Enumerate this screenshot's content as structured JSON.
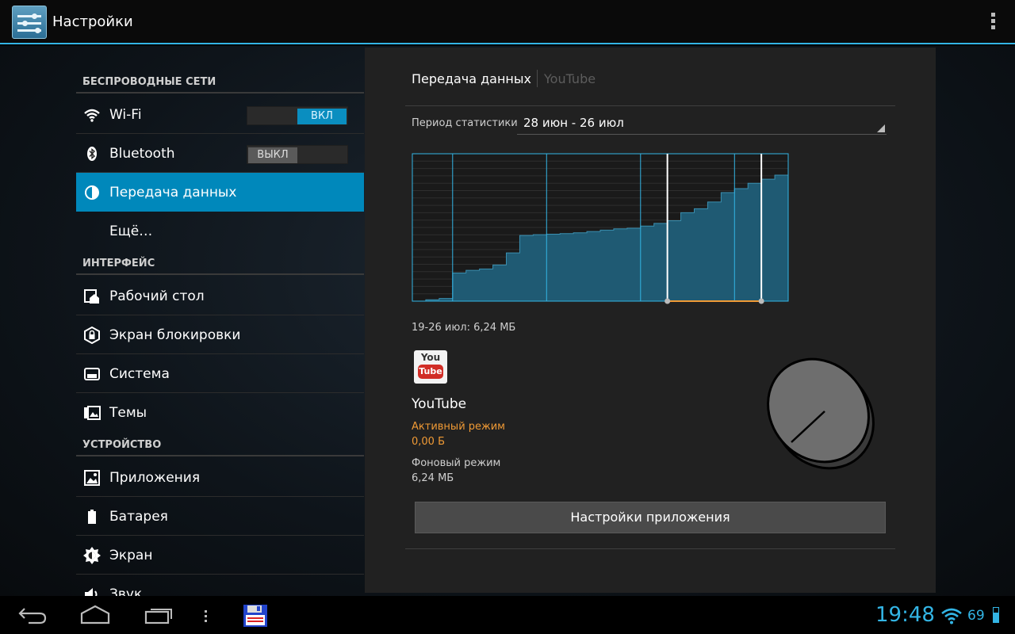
{
  "actionbar": {
    "title": "Настройки"
  },
  "sidebar": {
    "wireless_header": "БЕСПРОВОДНЫЕ СЕТИ",
    "wifi": {
      "label": "Wi-Fi",
      "toggle": "ВКЛ"
    },
    "bluetooth": {
      "label": "Bluetooth",
      "toggle": "ВЫКЛ"
    },
    "data_usage": {
      "label": "Передача данных"
    },
    "more": {
      "label": "Ещё…"
    },
    "interface_header": "ИНТЕРФЕЙС",
    "home": {
      "label": "Рабочий стол"
    },
    "lockscreen": {
      "label": "Экран блокировки"
    },
    "system": {
      "label": "Система"
    },
    "themes": {
      "label": "Темы"
    },
    "device_header": "УСТРОЙСТВО",
    "apps": {
      "label": "Приложения"
    },
    "battery": {
      "label": "Батарея"
    },
    "display": {
      "label": "Экран"
    },
    "sound": {
      "label": "Звук"
    }
  },
  "panel": {
    "title": "Передача данных",
    "subtitle": "YouTube",
    "period_label": "Период статистики",
    "period_value": "28 июн - 26 июл",
    "range_label": "19-26 июл: 6,24 МБ",
    "app": {
      "icon_top": "You",
      "icon_bottom": "Tube",
      "name": "YouTube",
      "foreground_label": "Активный режим",
      "foreground_value": "0,00 Б",
      "background_label": "Фоновый режим",
      "background_value": "6,24 МБ"
    },
    "settings_button": "Настройки приложения"
  },
  "statusbar": {
    "time": "19:48",
    "battery": "69"
  },
  "colors": {
    "accent": "#33b5e5",
    "selected": "#0088bb",
    "foreground_usage": "#f09a35",
    "chart_fill": "#1f5a73"
  },
  "chart_data": {
    "type": "area",
    "x": [
      0,
      1,
      2,
      3,
      4,
      5,
      6,
      7,
      8,
      9,
      10,
      11,
      12,
      13,
      14,
      15,
      16,
      17,
      18,
      19,
      20,
      21,
      22,
      23,
      24,
      25,
      26,
      27,
      28
    ],
    "values": [
      0.0,
      0.05,
      0.1,
      1.05,
      1.15,
      1.2,
      1.35,
      1.8,
      2.45,
      2.48,
      2.5,
      2.52,
      2.55,
      2.6,
      2.65,
      2.7,
      2.72,
      2.8,
      2.9,
      3.0,
      3.3,
      3.45,
      3.7,
      4.05,
      4.2,
      4.4,
      4.55,
      4.7,
      4.8
    ],
    "ylim": [
      0,
      5.5
    ],
    "grid": true,
    "selection": [
      19,
      26
    ]
  }
}
